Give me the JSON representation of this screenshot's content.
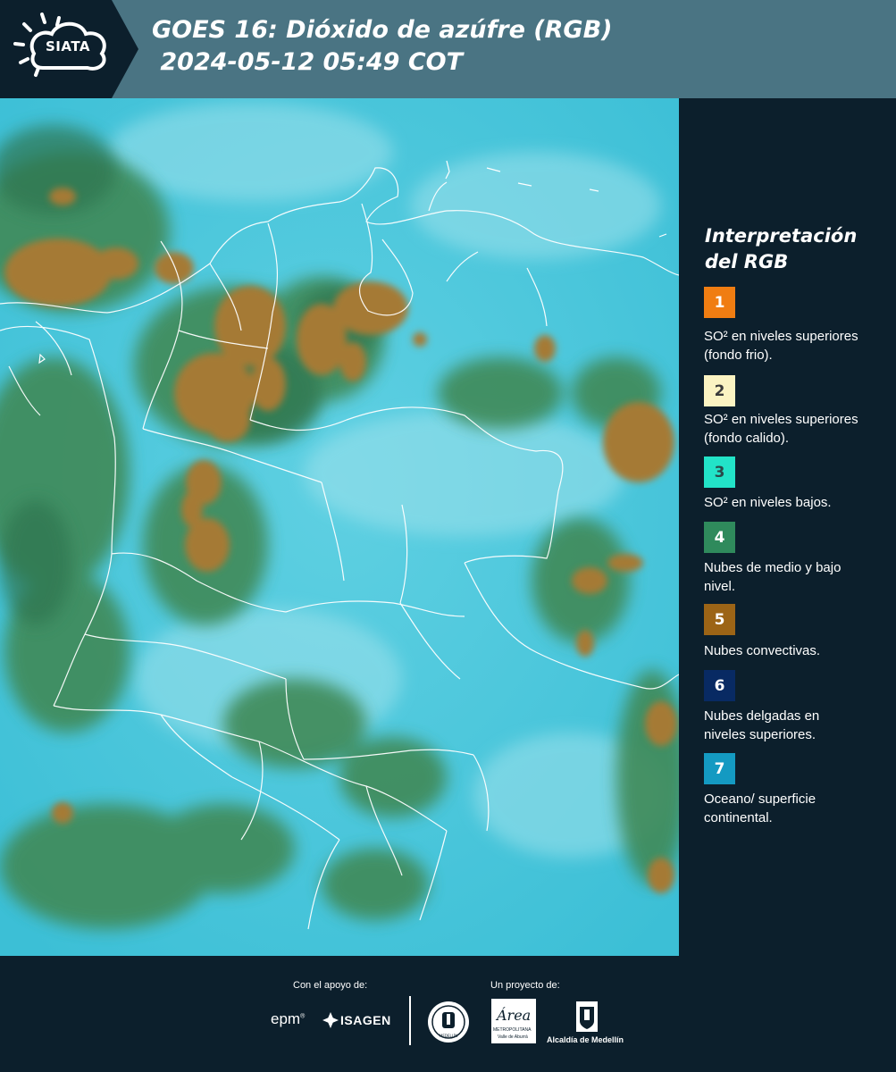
{
  "header": {
    "logo_label": "SIATA",
    "title_line1": "GOES 16: Dióxido de azúfre (RGB)",
    "title_line2": " 2024-05-12 05:49 COT"
  },
  "legend": {
    "title": "Interpretación del RGB",
    "items": [
      {
        "number": "1",
        "label": "SO² en niveles superiores (fondo frio).",
        "color": "#f07d12"
      },
      {
        "number": "2",
        "label": "SO² en niveles superiores (fondo calido).",
        "color": "#fbf3c2"
      },
      {
        "number": "3",
        "label": "SO² en niveles bajos.",
        "color": "#22e3c8"
      },
      {
        "number": "4",
        "label": "Nubes de medio y bajo nivel.",
        "color": "#2f8a5c"
      },
      {
        "number": "5",
        "label": "Nubes convectivas.",
        "color": "#9c6416"
      },
      {
        "number": "6",
        "label": "Nubes delgadas en niveles superiores.",
        "color": "#082a63"
      },
      {
        "number": "7",
        "label": "Oceano/ superficie continental.",
        "color": "#149ac2"
      }
    ]
  },
  "footer": {
    "support_label": "Con el apoyo de:",
    "project_label": "Un proyecto de:",
    "sponsor_epm": "epm",
    "sponsor_isagen": "ISAGEN",
    "partner_area": "Área",
    "partner_area_sub1": "METROPOLITANA",
    "partner_area_sub2": "Valle de Aburrá",
    "partner_alcaldia": "Alcaldía de Medellín",
    "seal_label": "MEDELLÍN"
  },
  "colors": {
    "header_bg": "#4a7483",
    "logo_bg": "#0c1f2c",
    "panel_bg": "#0c1f2c",
    "map_ocean": "#48c6da",
    "cloud_low": "#3f8a58",
    "cloud_convective": "#a57a34",
    "boundary": "#ffffff"
  }
}
